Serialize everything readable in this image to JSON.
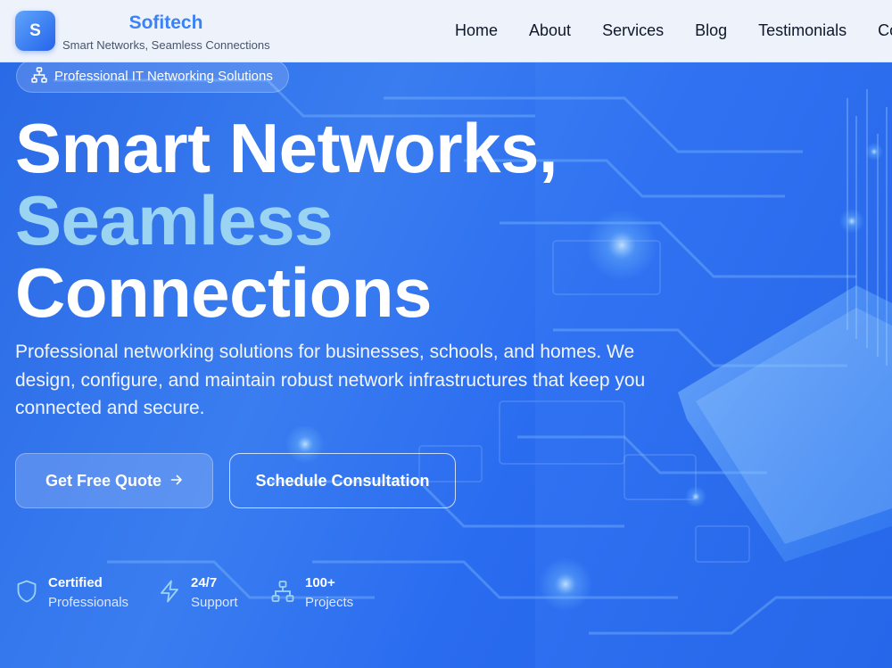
{
  "brand": {
    "logo_letter": "S",
    "name": "Sofitech",
    "tagline": "Smart Networks, Seamless Connections"
  },
  "nav": {
    "items": [
      "Home",
      "About",
      "Services",
      "Blog",
      "Testimonials",
      "Co"
    ]
  },
  "hero": {
    "badge": "Professional IT Networking Solutions",
    "title_line1": "Smart Networks,",
    "title_line2": "Seamless",
    "title_line3": "Connections",
    "description": "Professional networking solutions for businesses, schools, and homes. We design, configure, and maintain robust network infrastructures that keep you connected and secure.",
    "primary_button": "Get Free Quote",
    "secondary_button": "Schedule Consultation"
  },
  "stats": [
    {
      "title": "Certified",
      "subtitle": "Professionals",
      "icon": "shield-icon"
    },
    {
      "title": "24/7",
      "subtitle": "Support",
      "icon": "lightning-icon"
    },
    {
      "title": "100+",
      "subtitle": "Projects",
      "icon": "network-icon"
    }
  ],
  "colors": {
    "brand_accent": "#3b82f6",
    "hero_bg": "#2a6ae6",
    "title_accent": "#9bd4f3"
  }
}
